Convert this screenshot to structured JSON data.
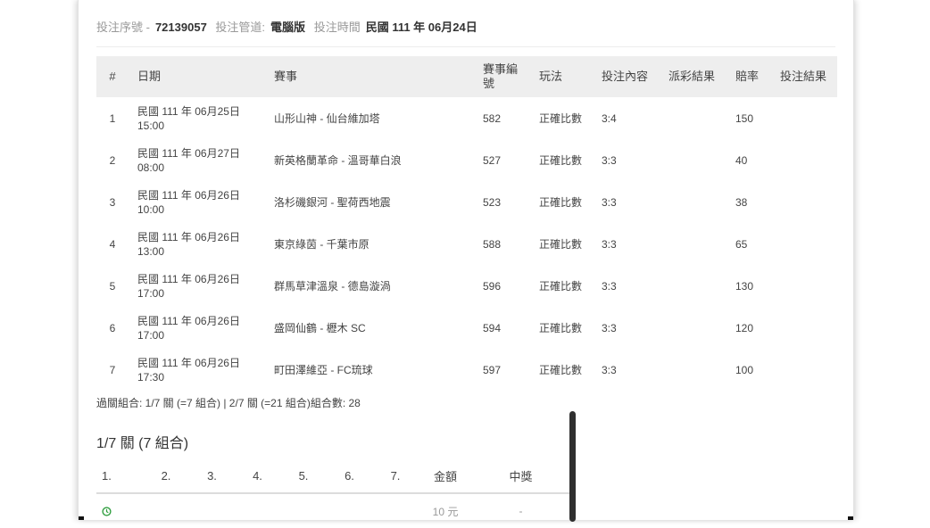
{
  "meta": {
    "serial_label": "投注序號 -",
    "serial_value": "72139057",
    "channel_label": "投注管道:",
    "channel_value": "電腦版",
    "time_label": "投注時間",
    "time_value": "民國 111 年 06月24日"
  },
  "table": {
    "headers": [
      "#",
      "日期",
      "賽事",
      "賽事編號",
      "玩法",
      "投注內容",
      "派彩結果",
      "賠率",
      "投注結果"
    ],
    "rows": [
      {
        "no": "1",
        "date": "民國 111 年 06月25日",
        "time": "15:00",
        "match": "山形山神 - 仙台維加塔",
        "id": "582",
        "play": "正確比數",
        "pick": "3:4",
        "payout": "",
        "odds": "150",
        "result": ""
      },
      {
        "no": "2",
        "date": "民國 111 年 06月27日",
        "time": "08:00",
        "match": "新英格蘭革命 - 溫哥華白浪",
        "id": "527",
        "play": "正確比數",
        "pick": "3:3",
        "payout": "",
        "odds": "40",
        "result": ""
      },
      {
        "no": "3",
        "date": "民國 111 年 06月26日",
        "time": "10:00",
        "match": "洛杉磯銀河 - 聖荷西地震",
        "id": "523",
        "play": "正確比數",
        "pick": "3:3",
        "payout": "",
        "odds": "38",
        "result": ""
      },
      {
        "no": "4",
        "date": "民國 111 年 06月26日",
        "time": "13:00",
        "match": "東京綠茵 - 千葉市原",
        "id": "588",
        "play": "正確比數",
        "pick": "3:3",
        "payout": "",
        "odds": "65",
        "result": ""
      },
      {
        "no": "5",
        "date": "民國 111 年 06月26日",
        "time": "17:00",
        "match": "群馬草津溫泉 - 德島漩渦",
        "id": "596",
        "play": "正確比數",
        "pick": "3:3",
        "payout": "",
        "odds": "130",
        "result": ""
      },
      {
        "no": "6",
        "date": "民國 111 年 06月26日",
        "time": "17:00",
        "match": "盛岡仙鶴 - 櫪木 SC",
        "id": "594",
        "play": "正確比數",
        "pick": "3:3",
        "payout": "",
        "odds": "120",
        "result": ""
      },
      {
        "no": "7",
        "date": "民國 111 年 06月26日",
        "time": "17:30",
        "match": "町田澤維亞 - FC琉球",
        "id": "597",
        "play": "正確比數",
        "pick": "3:3",
        "payout": "",
        "odds": "100",
        "result": ""
      }
    ]
  },
  "combo": {
    "summary": "過關組合: 1/7 關 (=7 組合) | 2/7 關 (=21 組合)組合數: 28",
    "title": "1/7 關 (7 組合)",
    "headers": [
      "1.",
      "2.",
      "3.",
      "4.",
      "5.",
      "6.",
      "7.",
      "金額",
      "中獎"
    ],
    "rows": [
      {
        "icon": "clock-icon",
        "cells": [
          "",
          "",
          "",
          "",
          "",
          "",
          ""
        ],
        "amount": "10 元",
        "win": "-"
      }
    ]
  },
  "colors": {
    "header_bg": "#eeeeee",
    "icon_green": "#2e9e3e"
  }
}
